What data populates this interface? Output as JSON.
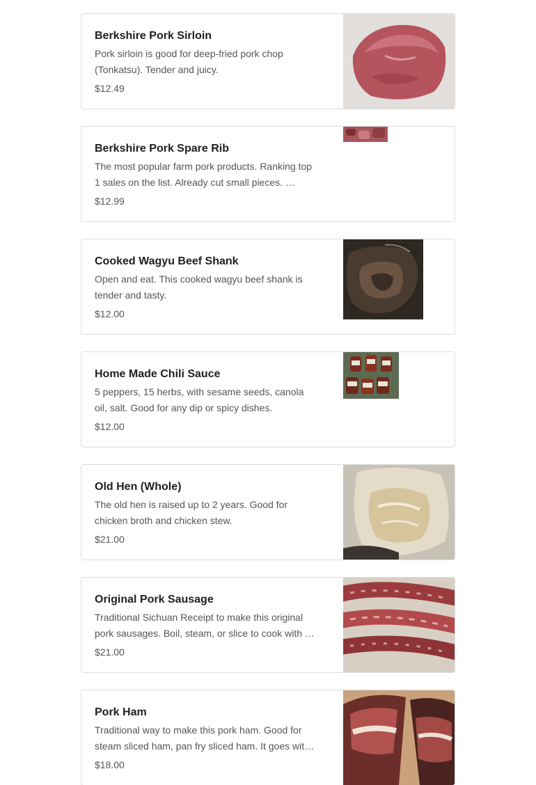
{
  "menu": {
    "items": [
      {
        "title": "",
        "description": "",
        "price": "",
        "image_icon": "meat-photo"
      },
      {
        "title": "Berkshire Pork Sirloin",
        "description": "Pork sirloin is good for deep-fried pork chop (Tonkatsu). Tender and juicy.",
        "price": "$12.49",
        "image_icon": "pork-sirloin-photo"
      },
      {
        "title": "Berkshire Pork Spare Rib",
        "description": "The most popular farm pork products. Ranking top 1 sales on the list. Already cut small pieces. …",
        "price": "$12.99",
        "image_icon": "spare-rib-photo"
      },
      {
        "title": "Cooked Wagyu Beef Shank",
        "description": "Open and eat. This cooked wagyu beef shank is tender and tasty.",
        "price": "$12.00",
        "image_icon": "beef-shank-photo"
      },
      {
        "title": "Home Made Chili Sauce",
        "description": "5 peppers, 15 herbs, with sesame seeds, canola oil, salt. Good for any dip or spicy dishes.",
        "price": "$12.00",
        "image_icon": "chili-sauce-photo"
      },
      {
        "title": "Old Hen (Whole)",
        "description": "The old hen is raised up to 2 years. Good for chicken broth and chicken stew.",
        "price": "$21.00",
        "image_icon": "old-hen-photo"
      },
      {
        "title": "Original Pork Sausage",
        "description": "Traditional Sichuan Receipt to make this original pork sausages. Boil, steam, or slice to cook with …",
        "price": "$21.00",
        "image_icon": "pork-sausage-photo"
      },
      {
        "title": "Pork Ham",
        "description": "Traditional way to make this pork ham. Good for steam sliced ham, pan fry sliced ham. It goes wit…",
        "price": "$18.00",
        "image_icon": "pork-ham-photo"
      }
    ]
  },
  "colors": {
    "card_border": "#dddddd",
    "title_text": "#1f1f1f",
    "body_text": "#555555"
  }
}
